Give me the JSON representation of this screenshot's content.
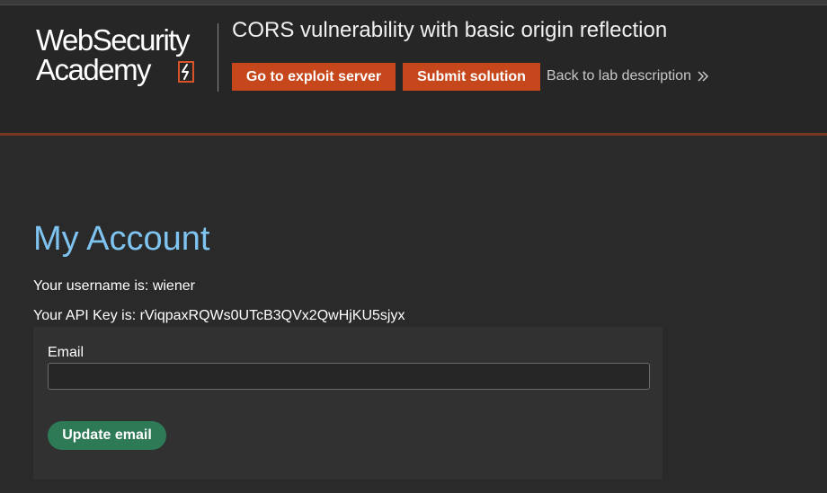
{
  "header": {
    "logo": {
      "line1": "WebSecurity",
      "line2": "Academy"
    },
    "lab_title": "CORS vulnerability with basic origin reflection",
    "exploit_button": "Go to exploit server",
    "submit_button": "Submit solution",
    "back_link": "Back to lab description",
    "back_icon": "double-chevron-right-icon"
  },
  "main": {
    "title": "My Account",
    "username_line": "Your username is: wiener",
    "apikey_line": "Your API Key is: rViqpaxRQWs0UTcB3QVx2QwHjKU5sjyx",
    "form": {
      "email_label": "Email",
      "email_value": "",
      "update_button": "Update email"
    }
  },
  "colors": {
    "accent_orange": "#c7471c",
    "title_blue": "#7fc4f0",
    "update_green": "#2e7a57",
    "background": "#2a2a2a"
  }
}
